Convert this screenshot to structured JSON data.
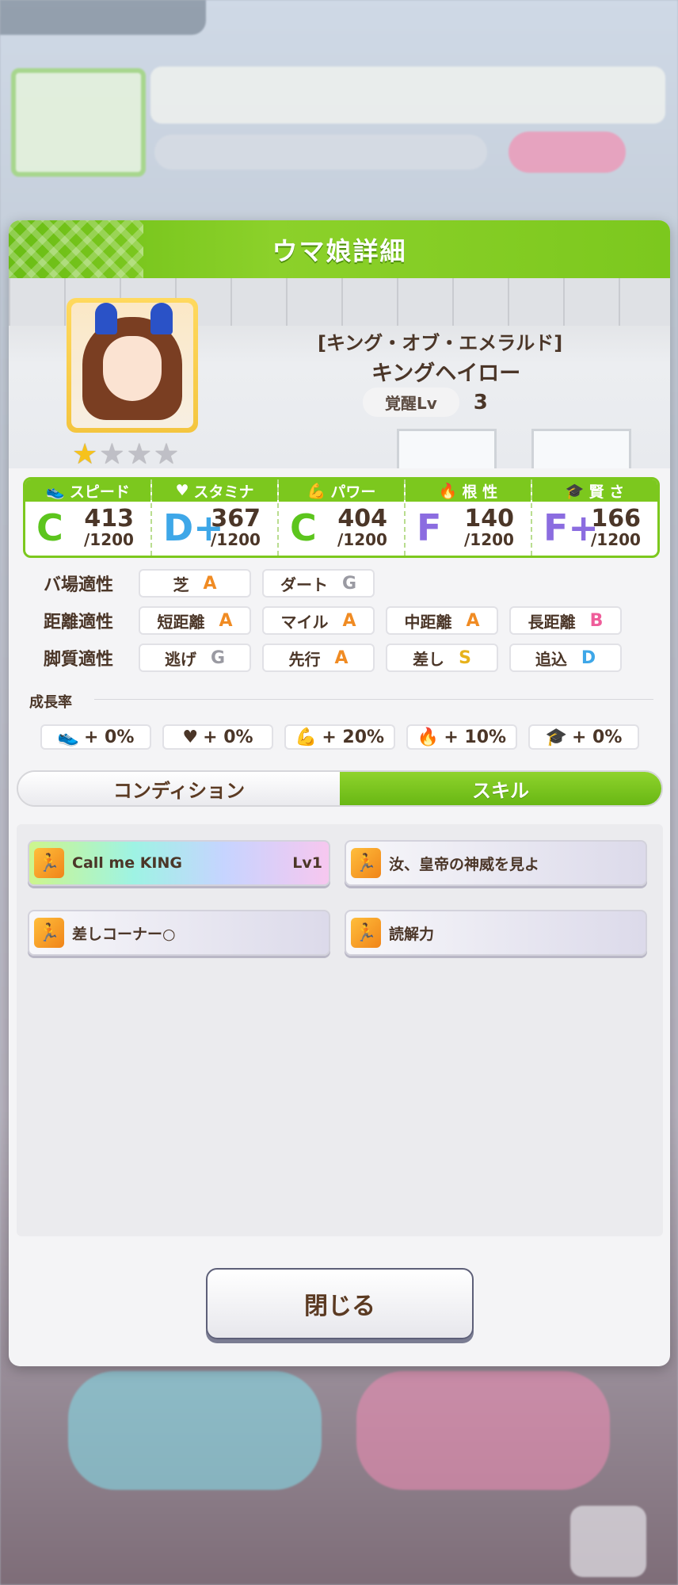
{
  "dialog": {
    "title": "ウマ娘詳細",
    "character": {
      "title": "[キング・オブ・エメラルド]",
      "name": "キングヘイロー",
      "awakening_label": "覚醒Lv",
      "awakening_value": "3",
      "stars": 1,
      "max_stars": 4
    },
    "stats": [
      {
        "label": "スピード",
        "icon": "shoe-icon",
        "grade": "C",
        "value": "413",
        "max": "/1200",
        "color": "#5cc51d"
      },
      {
        "label": "スタミナ",
        "icon": "heart-icon",
        "grade": "D+",
        "value": "367",
        "max": "/1200",
        "color": "#3ea7e8"
      },
      {
        "label": "パワー",
        "icon": "muscle-icon",
        "grade": "C",
        "value": "404",
        "max": "/1200",
        "color": "#5cc51d"
      },
      {
        "label": "根 性",
        "icon": "flame-icon",
        "grade": "F",
        "value": "140",
        "max": "/1200",
        "color": "#8b6ce0"
      },
      {
        "label": "賢 さ",
        "icon": "grad-cap-icon",
        "grade": "F+",
        "value": "166",
        "max": "/1200",
        "color": "#8b6ce0"
      }
    ],
    "aptitude": {
      "track": {
        "label": "バ場適性",
        "items": [
          {
            "name": "芝",
            "rank": "A"
          },
          {
            "name": "ダート",
            "rank": "G"
          }
        ]
      },
      "distance": {
        "label": "距離適性",
        "items": [
          {
            "name": "短距離",
            "rank": "A"
          },
          {
            "name": "マイル",
            "rank": "A"
          },
          {
            "name": "中距離",
            "rank": "A"
          },
          {
            "name": "長距離",
            "rank": "B"
          }
        ]
      },
      "style": {
        "label": "脚質適性",
        "items": [
          {
            "name": "逃げ",
            "rank": "G"
          },
          {
            "name": "先行",
            "rank": "A"
          },
          {
            "name": "差し",
            "rank": "S"
          },
          {
            "name": "追込",
            "rank": "D"
          }
        ]
      }
    },
    "rank_colors": {
      "A": "#f08b23",
      "B": "#ef5d9a",
      "S": "#e7b21b",
      "D": "#3ea7e8",
      "G": "#9a9aa2"
    },
    "growth": {
      "title": "成長率",
      "items": [
        {
          "icon": "shoe-icon",
          "value": "+ 0%"
        },
        {
          "icon": "heart-icon",
          "value": "+ 0%"
        },
        {
          "icon": "muscle-icon",
          "value": "+ 20%"
        },
        {
          "icon": "flame-icon",
          "value": "+ 10%"
        },
        {
          "icon": "grad-cap-icon",
          "value": "+ 0%"
        }
      ]
    },
    "tabs": [
      {
        "label": "コンディション",
        "active": false
      },
      {
        "label": "スキル",
        "active": true
      }
    ],
    "skills": [
      {
        "name": "Call me KING",
        "level": "Lv1",
        "type": "unique"
      },
      {
        "name": "汝、皇帝の神威を見よ",
        "level": "",
        "type": "normal"
      },
      {
        "name": "差しコーナー○",
        "level": "",
        "type": "normal"
      },
      {
        "name": "読解力",
        "level": "",
        "type": "normal"
      }
    ],
    "close_label": "閉じる"
  },
  "colors": {
    "accent_green": "#7cc81e"
  }
}
